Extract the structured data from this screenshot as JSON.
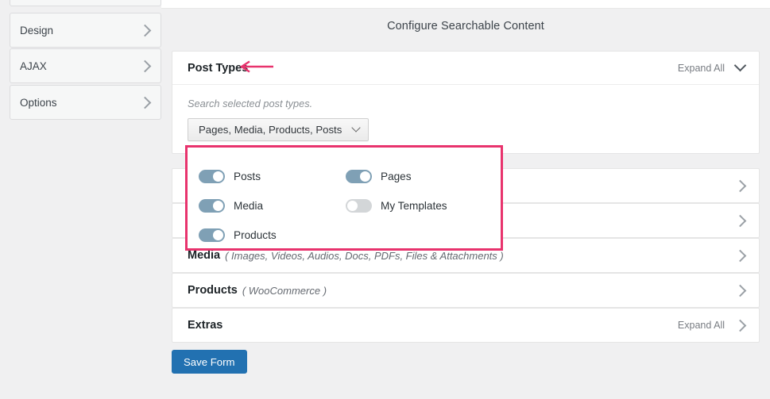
{
  "sidebar": {
    "items": [
      {
        "label": "",
        "partial": true
      },
      {
        "label": "Design"
      },
      {
        "label": "AJAX"
      },
      {
        "label": "Options"
      }
    ]
  },
  "main": {
    "page_title": "Configure Searchable Content",
    "save_label": "Save Form",
    "expand_all_label": "Expand All",
    "post_types": {
      "title": "Post Types",
      "expand_all_label": "Expand All",
      "hint": "Search selected post types.",
      "select_value": "Pages, Media, Products, Posts",
      "toggles": [
        {
          "label": "Posts",
          "state": "on"
        },
        {
          "label": "Pages",
          "state": "on"
        },
        {
          "label": "Media",
          "state": "on"
        },
        {
          "label": "My Templates",
          "state": "off"
        },
        {
          "label": "Products",
          "state": "on"
        }
      ]
    },
    "rows": [
      {
        "title": "",
        "sub": ""
      },
      {
        "title": "",
        "sub": ""
      },
      {
        "title": "Media",
        "sub": "( Images, Videos, Audios, Docs, PDFs, Files & Attachments )"
      },
      {
        "title": "Products",
        "sub": "( WooCommerce )"
      },
      {
        "title": "Extras",
        "sub": "",
        "expand_all": "Expand All"
      }
    ]
  },
  "colors": {
    "accent_blue": "#2271b1",
    "annotation_pink": "#e8336d",
    "toggle_on": "#7fa0b5",
    "toggle_off": "#d3d6d8",
    "page_bg": "#f0f0f1"
  }
}
